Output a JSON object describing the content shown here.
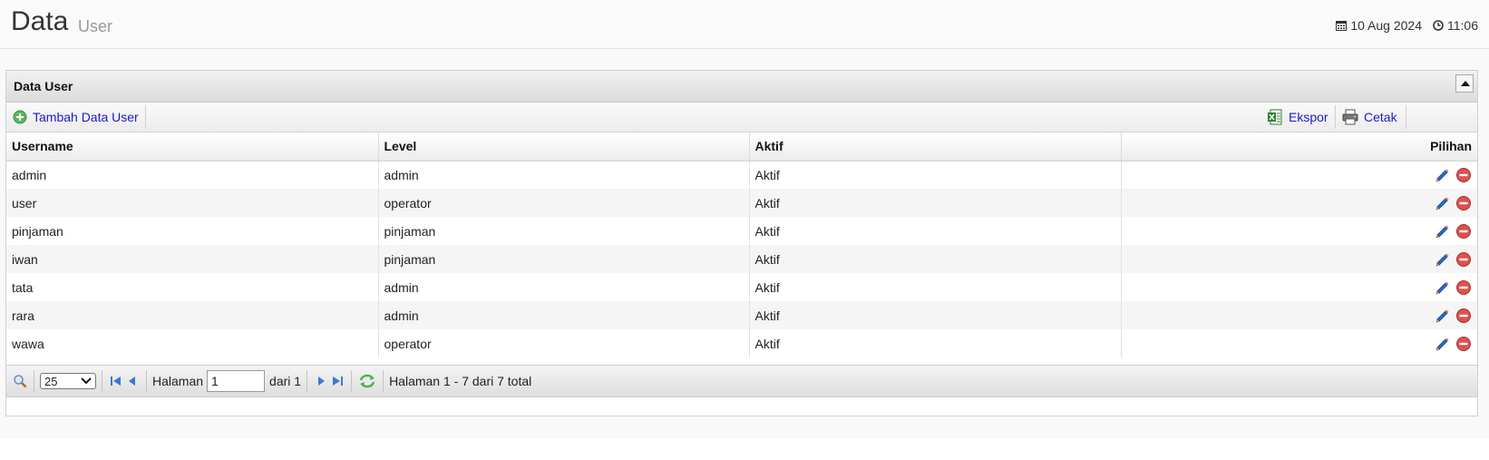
{
  "header": {
    "title": "Data",
    "subtitle": "User",
    "date": "10 Aug 2024",
    "time": "11:06"
  },
  "panel": {
    "title": "Data User"
  },
  "toolbar": {
    "add_label": "Tambah Data User",
    "export_label": "Ekspor",
    "print_label": "Cetak"
  },
  "table": {
    "columns": [
      "Username",
      "Level",
      "Aktif",
      "Pilihan"
    ],
    "rows": [
      {
        "username": "admin",
        "level": "admin",
        "aktif": "Aktif"
      },
      {
        "username": "user",
        "level": "operator",
        "aktif": "Aktif"
      },
      {
        "username": "pinjaman",
        "level": "pinjaman",
        "aktif": "Aktif"
      },
      {
        "username": "iwan",
        "level": "pinjaman",
        "aktif": "Aktif"
      },
      {
        "username": "tata",
        "level": "admin",
        "aktif": "Aktif"
      },
      {
        "username": "rara",
        "level": "admin",
        "aktif": "Aktif"
      },
      {
        "username": "wawa",
        "level": "operator",
        "aktif": "Aktif"
      }
    ]
  },
  "pager": {
    "page_size": "25",
    "page_label": "Halaman",
    "page_value": "1",
    "of_label": "dari 1",
    "summary": "Halaman 1 - 7 dari 7 total"
  },
  "colors": {
    "link": "#1a1acc",
    "add_icon": "#5cb85c",
    "edit_icon": "#2b6fd6",
    "delete_icon": "#d9534f"
  }
}
